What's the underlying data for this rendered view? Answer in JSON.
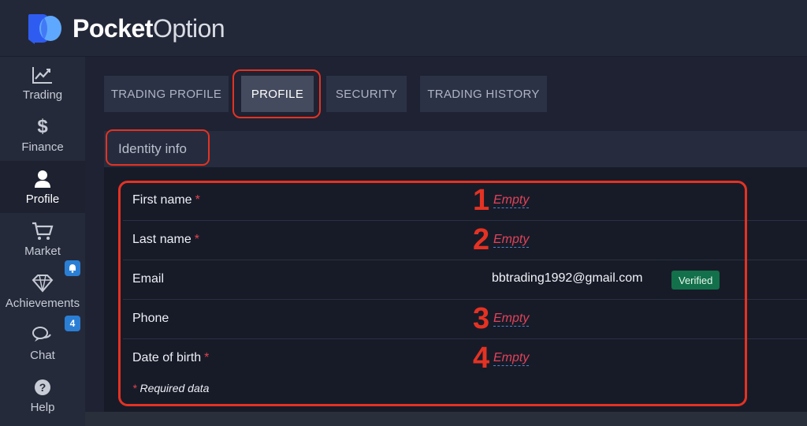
{
  "brand": {
    "name_bold": "Pocket",
    "name_light": "Option",
    "colors": {
      "left": "#2f5cf0",
      "right": "#5fa8ff"
    }
  },
  "sidebar": {
    "items": [
      {
        "label": "Trading",
        "icon": "chart-line-icon"
      },
      {
        "label": "Finance",
        "icon": "dollar-icon"
      },
      {
        "label": "Profile",
        "icon": "user-icon",
        "active": true
      },
      {
        "label": "Market",
        "icon": "cart-icon"
      },
      {
        "label": "Achievements",
        "icon": "diamond-icon",
        "badge_icon": "bell-icon"
      },
      {
        "label": "Chat",
        "icon": "chat-icon",
        "badge": "4"
      },
      {
        "label": "Help",
        "icon": "help-icon"
      }
    ]
  },
  "tabs": [
    {
      "label": "TRADING PROFILE"
    },
    {
      "label": "PROFILE",
      "active": true
    },
    {
      "label": "SECURITY"
    },
    {
      "label": "TRADING HISTORY"
    }
  ],
  "section": {
    "title": "Identity info"
  },
  "fields": [
    {
      "label": "First name",
      "required": true,
      "value": "Empty",
      "step": "1"
    },
    {
      "label": "Last name",
      "required": true,
      "value": "Empty",
      "step": "2"
    },
    {
      "label": "Email",
      "required": false,
      "value": "bbtrading1992@gmail.com",
      "status": "Verified"
    },
    {
      "label": "Phone",
      "required": false,
      "value": "Empty",
      "step": "3"
    },
    {
      "label": "Date of birth",
      "required": true,
      "value": "Empty",
      "step": "4"
    }
  ],
  "required_note": {
    "star": "*",
    "text": "Required data"
  },
  "required_star": "*",
  "accent_colors": {
    "annotation": "#e43223",
    "verified": "#12704a",
    "empty_value": "#e0435a"
  }
}
